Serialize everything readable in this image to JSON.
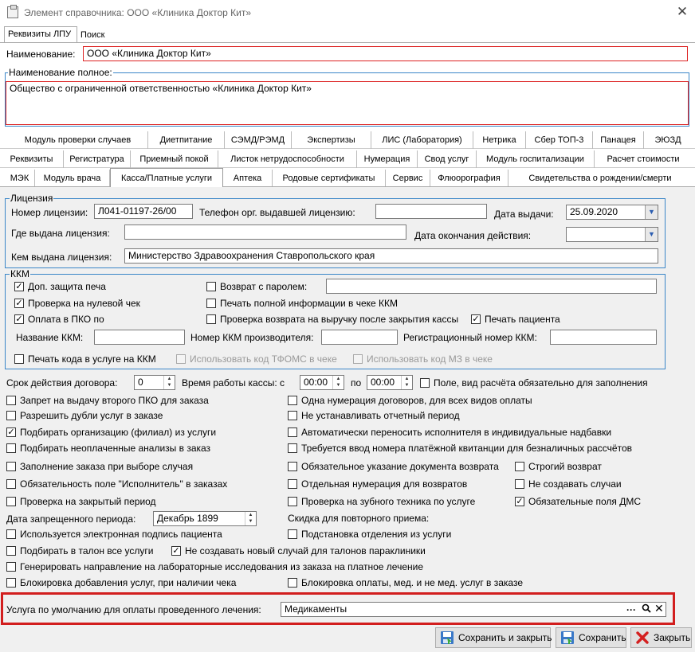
{
  "window": {
    "title": "Элемент справочника: ООО «Клиника Доктор Кит»",
    "close_glyph": "✕"
  },
  "top_tabs": [
    "Реквизиты ЛПУ",
    "Поиск"
  ],
  "name": {
    "label": "Наименование:",
    "value": "ООО «Клиника Доктор Кит»"
  },
  "full_name": {
    "label": "Наименование полное:",
    "value": "Общество с ограниченной ответственностью «Клиника Доктор Кит»"
  },
  "tab_rows": [
    [
      "Модуль проверки случаев",
      "Диетпитание",
      "СЭМД/РЭМД",
      "Экспертизы",
      "ЛИС (Лаборатория)",
      "Нетрика",
      "Сбер ТОП-3",
      "Панацея",
      "ЭЮЗД"
    ],
    [
      "Реквизиты",
      "Регистратура",
      "Приемный покой",
      "Листок нетрудоспособности",
      "Нумерация",
      "Свод услуг",
      "Модуль госпитализации",
      "Расчет стоимости"
    ],
    [
      "МЭК",
      "Модуль врача",
      "Касса/Платные услуги",
      "Аптека",
      "Родовые сертификаты",
      "Сервис",
      "Флюорография",
      "Свидетельства о рождении/смерти"
    ]
  ],
  "license": {
    "caption": "Лицензия",
    "number_label": "Номер лицензии:",
    "number_value": "Л041-01197-26/00",
    "phone_label": "Телефон орг. выдавшей лицензию:",
    "phone_value": "",
    "issue_date_label": "Дата выдачи:",
    "issue_date_value": "25.09.2020",
    "where_label": "Где выдана лицензия:",
    "where_value": "",
    "end_date_label": "Дата окончания действия:",
    "end_date_value": "",
    "by_label": "Кем выдана лицензия:",
    "by_value": "Министерство Здравоохранения Ставропольского края"
  },
  "kkm": {
    "caption": "ККМ",
    "extra_protect": "Доп. защита печа",
    "zero_check": "Проверка на нулевой чек",
    "pko_pay": "Оплата в ПКО по",
    "password_return": "Возврат с паролем:",
    "password_value": "",
    "full_info": "Печать полной информации в чеке ККМ",
    "return_check": "Проверка возврата на выручку после закрытия кассы",
    "print_patient": "Печать пациента",
    "kkm_name_label": "Название ККМ:",
    "kkm_name_value": "",
    "kkm_maker_label": "Номер ККМ производителя:",
    "kkm_maker_value": "",
    "kkm_reg_label": "Регистрационный номер ККМ:",
    "kkm_reg_value": "",
    "print_code": "Печать кода в услуге на ККМ",
    "tfoms_code": "Использовать код ТФОМС в чеке",
    "mz_code": "Использовать код МЗ в чеке"
  },
  "contract": {
    "term_label": "Срок действия договора:",
    "term_value": "0",
    "hours_label": "Время работы кассы: с",
    "from_value": "00:00",
    "to_label": "по",
    "to_value": "00:00",
    "calc_field": "Поле, вид расчёта обязательно для заполнения"
  },
  "options": {
    "o1": "Запрет на выдачу второго ПКО для заказа",
    "o2": "Разрешить дубли услуг в заказе",
    "o3": "Подбирать организацию (филиал) из услуги",
    "o4": "Подбирать неоплаченные анализы в заказ",
    "o5": "Заполнение заказа при выборе случая",
    "o6": "Обязательность поле \"Исполнитель\" в заказах",
    "o7": "Проверка на закрытый период",
    "r1": "Одна нумерация договоров, для всех видов оплаты",
    "r2": "Не устанавливать отчетный период",
    "r3": "Автоматически переносить исполнителя в индивидуальные надбавки",
    "r4": "Требуется ввод номера платёжной квитанции для безналичных рассчётов",
    "r5": "Обязательное указание документа возврата",
    "r6": "Отдельная нумерация для возвратов",
    "r7": "Проверка на зубного техника по услуге",
    "s1": "Строгий возврат",
    "s2": "Не создавать случаи",
    "s3": "Обязательные поля ДМС",
    "forbid_label": "Дата запрещенного периода:",
    "forbid_value": "Декабрь  1899",
    "repeat_label": "Скидка для повторного приема:",
    "e_sign": "Используется электронная подпись пациента",
    "substitute": "Подстановка отделения из услуги",
    "talon": "Подбирать в талон все услуги",
    "no_new_case": "Не создавать новый случай для талонов параклиники",
    "lab_direction": "Генерировать направление на лабораторные исследования из заказа на платное лечение",
    "block_add": "Блокировка добавления услуг, при наличии чека",
    "block_pay": "Блокировка оплаты, мед. и не мед. услуг в заказе"
  },
  "default_service": {
    "label": "Услуга по умолчанию для оплаты проведенного лечения:",
    "value": "Медикаменты"
  },
  "buttons": {
    "save_close": "Сохранить и закрыть",
    "save": "Сохранить",
    "close": "Закрыть"
  }
}
